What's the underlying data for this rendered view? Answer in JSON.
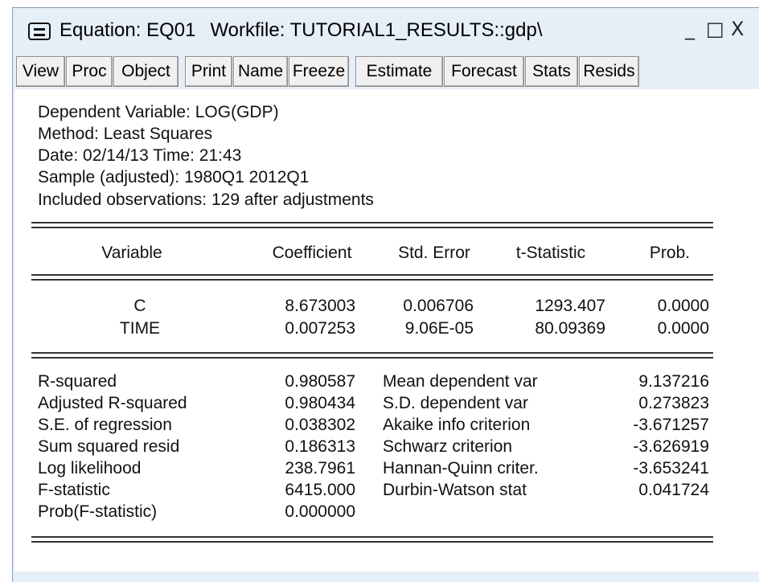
{
  "window": {
    "title": "Equation: EQ01",
    "workfile": "Workfile: TUTORIAL1_RESULTS::gdp\\",
    "controls": {
      "minimize": "_",
      "maximize": "□",
      "close": "X"
    }
  },
  "toolbar": {
    "view": "View",
    "proc": "Proc",
    "object": "Object",
    "print": "Print",
    "name": "Name",
    "freeze": "Freeze",
    "estimate": "Estimate",
    "forecast": "Forecast",
    "stats": "Stats",
    "resids": "Resids"
  },
  "header": {
    "dependent": "Dependent Variable: LOG(GDP)",
    "method": "Method: Least Squares",
    "date": "Date: 02/14/13   Time: 21:43",
    "sample": "Sample (adjusted): 1980Q1 2012Q1",
    "observations": "Included observations: 129 after adjustments"
  },
  "coef_table": {
    "headers": [
      "Variable",
      "Coefficient",
      "Std. Error",
      "t-Statistic",
      "Prob."
    ],
    "rows": [
      [
        "C",
        "8.673003",
        "0.006706",
        "1293.407",
        "0.0000"
      ],
      [
        "TIME",
        "0.007253",
        "9.06E-05",
        "80.09369",
        "0.0000"
      ]
    ]
  },
  "stats": {
    "left": [
      [
        "R-squared",
        "0.980587"
      ],
      [
        "Adjusted R-squared",
        "0.980434"
      ],
      [
        "S.E. of regression",
        "0.038302"
      ],
      [
        "Sum squared resid",
        "0.186313"
      ],
      [
        "Log likelihood",
        "238.7961"
      ],
      [
        "F-statistic",
        "6415.000"
      ],
      [
        "Prob(F-statistic)",
        "0.000000"
      ]
    ],
    "right": [
      [
        "Mean dependent var",
        "9.137216"
      ],
      [
        "S.D. dependent var",
        "0.273823"
      ],
      [
        "Akaike info criterion",
        "-3.671257"
      ],
      [
        "Schwarz criterion",
        "-3.626919"
      ],
      [
        "Hannan-Quinn criter.",
        "-3.653241"
      ],
      [
        "Durbin-Watson stat",
        "0.041724"
      ]
    ]
  }
}
